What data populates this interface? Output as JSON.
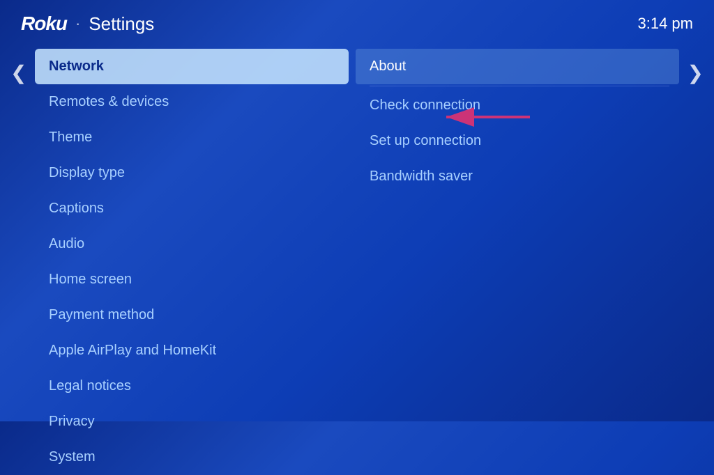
{
  "header": {
    "logo": "Roku",
    "separator": "·",
    "title": "Settings",
    "time": "3:14 pm"
  },
  "nav": {
    "left_arrow": "❮",
    "right_arrow": "❯"
  },
  "left_menu": {
    "items": [
      {
        "label": "Network",
        "active": true
      },
      {
        "label": "Remotes & devices",
        "active": false
      },
      {
        "label": "Theme",
        "active": false
      },
      {
        "label": "Display type",
        "active": false
      },
      {
        "label": "Captions",
        "active": false
      },
      {
        "label": "Audio",
        "active": false
      },
      {
        "label": "Home screen",
        "active": false
      },
      {
        "label": "Payment method",
        "active": false
      },
      {
        "label": "Apple AirPlay and HomeKit",
        "active": false
      },
      {
        "label": "Legal notices",
        "active": false
      },
      {
        "label": "Privacy",
        "active": false
      },
      {
        "label": "System",
        "active": false
      }
    ]
  },
  "right_menu": {
    "items": [
      {
        "label": "About",
        "active": true
      },
      {
        "label": "Check connection",
        "active": false
      },
      {
        "label": "Set up connection",
        "active": false
      },
      {
        "label": "Bandwidth saver",
        "active": false
      }
    ]
  }
}
